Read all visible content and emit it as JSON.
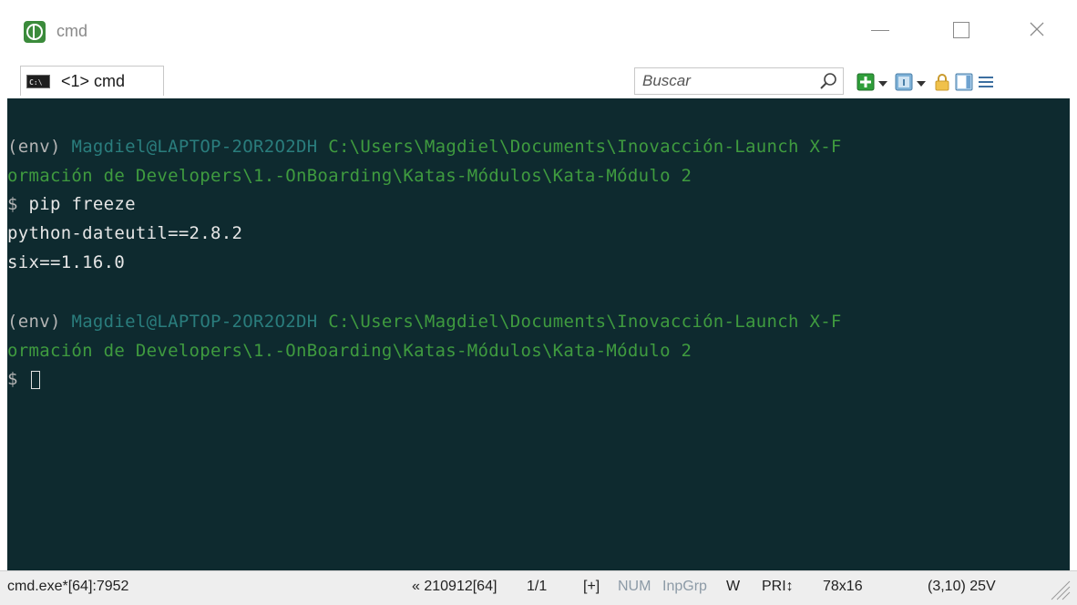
{
  "window": {
    "title": "cmd",
    "controls": {
      "minimize": "—",
      "maximize": "☐",
      "close": "✕"
    }
  },
  "tabs": [
    {
      "icon": "console-icon",
      "icon_text": "C:\\",
      "label": "<1> cmd"
    }
  ],
  "search": {
    "placeholder": "Buscar",
    "value": ""
  },
  "toolbar_icons": [
    "search-icon",
    "new-console-icon",
    "restore-panes-icon",
    "lock-icon",
    "layout-icon",
    "menu-icon"
  ],
  "terminal": {
    "background": "#0e2a2f",
    "blocks": [
      {
        "env": "(env)",
        "user_host": "Magdiel@LAPTOP-2OR2O2DH",
        "path_line1": "C:\\Users\\Magdiel\\Documents\\Inovacción-Launch X-F",
        "path_line2": "ormación de Developers\\1.-OnBoarding\\Katas-Módulos\\Kata-Módulo 2",
        "prompt": "$",
        "command": "pip freeze",
        "output": [
          "python-dateutil==2.8.2",
          "six==1.16.0"
        ]
      },
      {
        "env": "(env)",
        "user_host": "Magdiel@LAPTOP-2OR2O2DH",
        "path_line1": "C:\\Users\\Magdiel\\Documents\\Inovacción-Launch X-F",
        "path_line2": "ormación de Developers\\1.-OnBoarding\\Katas-Módulos\\Kata-Módulo 2",
        "prompt": "$",
        "command": ""
      }
    ]
  },
  "statusbar": {
    "process": "cmd.exe*[64]:7952",
    "build": "« 210912[64]",
    "console_index": "1/1",
    "plus": "[+]",
    "num": "NUM",
    "inp_grp": "InpGrp",
    "w": "W",
    "pri": "PRI↕",
    "size": "78x16",
    "cursor_pos": "(3,10) 25V"
  },
  "colors": {
    "env": "#b4b4b4",
    "user_host": "#2a7d7d",
    "path": "#3f9b3f",
    "text": "#e6e6e6"
  }
}
